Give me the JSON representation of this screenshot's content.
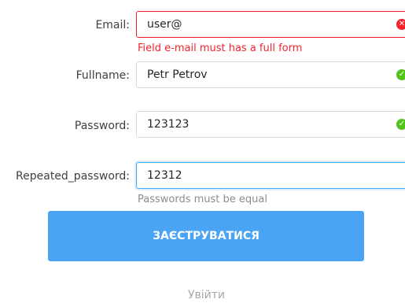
{
  "form": {
    "email": {
      "label": "Email:",
      "value": "user@",
      "error": "Field e-mail must has a full form",
      "status_icon": "close-circle-icon",
      "status_color": "#f5222d"
    },
    "fullname": {
      "label": "Fullname:",
      "value": "Petr Petrov",
      "status_icon": "check-circle-icon",
      "status_color": "#52c41a"
    },
    "password": {
      "label": "Password:",
      "value": "123123",
      "status_icon": "check-circle-icon",
      "status_color": "#52c41a"
    },
    "repeated_password": {
      "label": "Repeated_password:",
      "value": "12312",
      "hint": "Passwords must be equal"
    },
    "submit_label": "ЗАЄСТРУВАТИСЯ",
    "login_label": "Увійти"
  },
  "colors": {
    "accent": "#4aa4f3",
    "error": "#f5222d",
    "success": "#52c41a"
  }
}
